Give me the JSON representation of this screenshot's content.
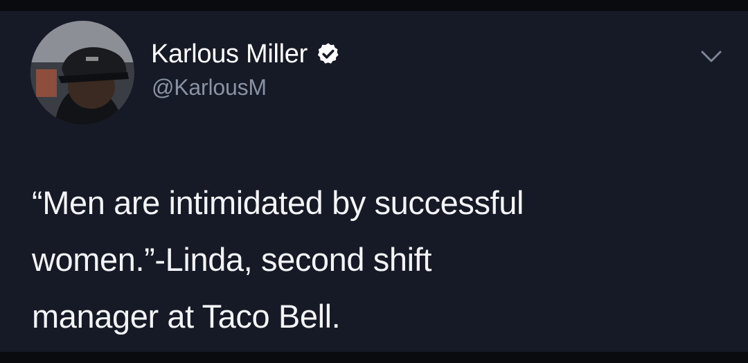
{
  "tweet": {
    "author_name": "Karlous Miller",
    "handle": "@KarlousM",
    "text": "“Men are intimidated by successful\nwomen.”-Linda, second shift\nmanager at Taco Bell.",
    "avatar_icon": "profile-photo",
    "verified_icon": "verified-badge-icon",
    "menu_icon": "chevron-down-icon"
  },
  "colors": {
    "background": "#161a26",
    "frame": "#0a0b0f",
    "text": "#ffffff",
    "handle": "#8a93a3"
  }
}
